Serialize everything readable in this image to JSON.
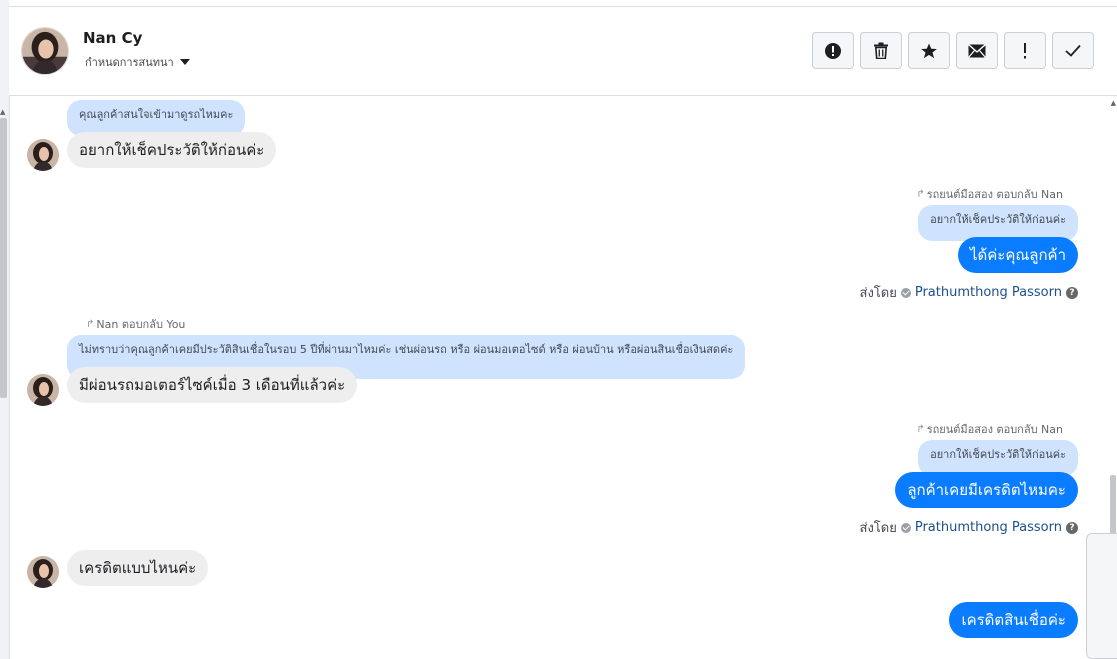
{
  "header": {
    "name": "Nan Cy",
    "subtitle": "กำหนดการสนทนา",
    "actions": [
      {
        "name": "report-button",
        "icon": "alert-circle-icon"
      },
      {
        "name": "delete-button",
        "icon": "trash-icon"
      },
      {
        "name": "star-button",
        "icon": "star-icon"
      },
      {
        "name": "mark-unread-button",
        "icon": "envelope-icon"
      },
      {
        "name": "important-button",
        "icon": "exclamation-icon"
      },
      {
        "name": "done-button",
        "icon": "check-icon"
      }
    ]
  },
  "messages": {
    "m1": {
      "quote": "คุณลูกค้าสนใจเข้ามาดูรถไหมคะ",
      "text": "อยากให้เช็คประวัติให้ก่อนค่ะ"
    },
    "m2": {
      "reply_meta": "รถยนต์มือสอง ตอบกลับ Nan",
      "quote": "อยากให้เช็คประวัติให้ก่อนค่ะ",
      "text": "ได้ค่ะคุณลูกค้า",
      "sent_by_label": "ส่งโดย",
      "agent": "Prathumthong Passorn"
    },
    "m3": {
      "reply_meta": "Nan ตอบกลับ You",
      "quote": "ไม่ทราบว่าคุณลูกค้าเคยมีประวัติสินเชื่อในรอบ 5 ปีที่ผ่านมาไหมค่ะ เช่นผ่อนรถ หรือ ผ่อนมอเตอไซด์ หรือ ผ่อนบ้าน หรือผ่อนสินเชื่อเงินสดค่ะ",
      "text": "มีผ่อนรถมอเตอร์ไซค์เมื่อ 3 เดือนที่แล้วค่ะ"
    },
    "m4": {
      "reply_meta": "รถยนต์มือสอง ตอบกลับ Nan",
      "quote": "อยากให้เช็คประวัติให้ก่อนค่ะ",
      "text": "ลูกค้าเคยมีเครดิตไหมคะ",
      "sent_by_label": "ส่งโดย",
      "agent": "Prathumthong Passorn"
    },
    "m5": {
      "text": "เครดิตแบบไหนค่ะ"
    },
    "m6": {
      "text": "เครดิตสินเชื่อค่ะ"
    }
  },
  "colors": {
    "accent": "#0a7cff",
    "quote_bg": "#cfe3ff",
    "incoming_bg": "#eeeeef"
  }
}
